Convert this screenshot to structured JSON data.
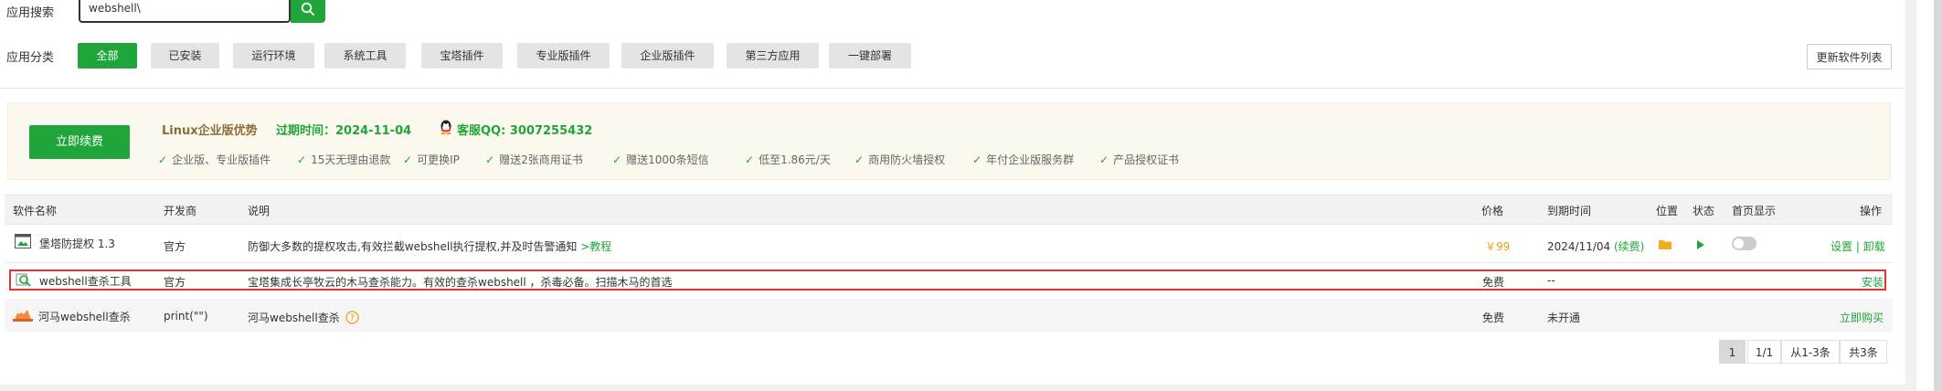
{
  "search": {
    "label": "应用搜索",
    "value": "webshell\\"
  },
  "categories": {
    "label": "应用分类",
    "items": [
      "全部",
      "已安装",
      "运行环境",
      "系统工具",
      "宝塔插件",
      "专业版插件",
      "企业版插件",
      "第三方应用",
      "一键部署"
    ],
    "active": "全部"
  },
  "update_list_button": "更新软件列表",
  "promo": {
    "renew_button": "立即续费",
    "title": "Linux企业版优势",
    "expire": "过期时间：2024-11-04",
    "qq": "客服QQ: 3007255432",
    "features": [
      "企业版、专业版插件",
      "15天无理由退款",
      "可更换IP",
      "赠送2张商用证书",
      "赠送1000条短信",
      "低至1.86元/天",
      "商用防火墙授权",
      "年付企业版服务群",
      "产品授权证书"
    ]
  },
  "table": {
    "headers": {
      "name": "软件名称",
      "developer": "开发商",
      "desc": "说明",
      "price": "价格",
      "expire": "到期时间",
      "location": "位置",
      "status": "状态",
      "homepage": "首页显示",
      "action": "操作"
    },
    "rows": [
      {
        "name": "堡塔防提权 1.3",
        "developer": "官方",
        "desc": "防御大多数的提权攻击,有效拦截webshell执行提权,并及时告警通知",
        "desc_link": ">教程",
        "price": "￥99",
        "expire": "2024/11/04",
        "renew": "(续费)",
        "action_1": "设置",
        "action_sep": "|",
        "action_2": "卸载"
      },
      {
        "name": "webshell查杀工具",
        "developer": "官方",
        "desc": "宝塔集成长亭牧云的木马查杀能力。有效的查杀webshell ，杀毒必备。扫描木马的首选",
        "price": "免费",
        "expire": "--",
        "action": "安装"
      },
      {
        "name": "河马webshell查杀",
        "developer": "print(\"\")",
        "desc": "河马webshell查杀",
        "price": "免费",
        "expire": "未开通",
        "action": "立即购买"
      }
    ]
  },
  "pagination": {
    "current": "1",
    "pages": "1/1",
    "range": "从1-3条",
    "total": "共3条"
  },
  "colors": {
    "brand_green": "#20a53a",
    "price_orange": "#f39c12",
    "highlight_red": "#e53333"
  }
}
